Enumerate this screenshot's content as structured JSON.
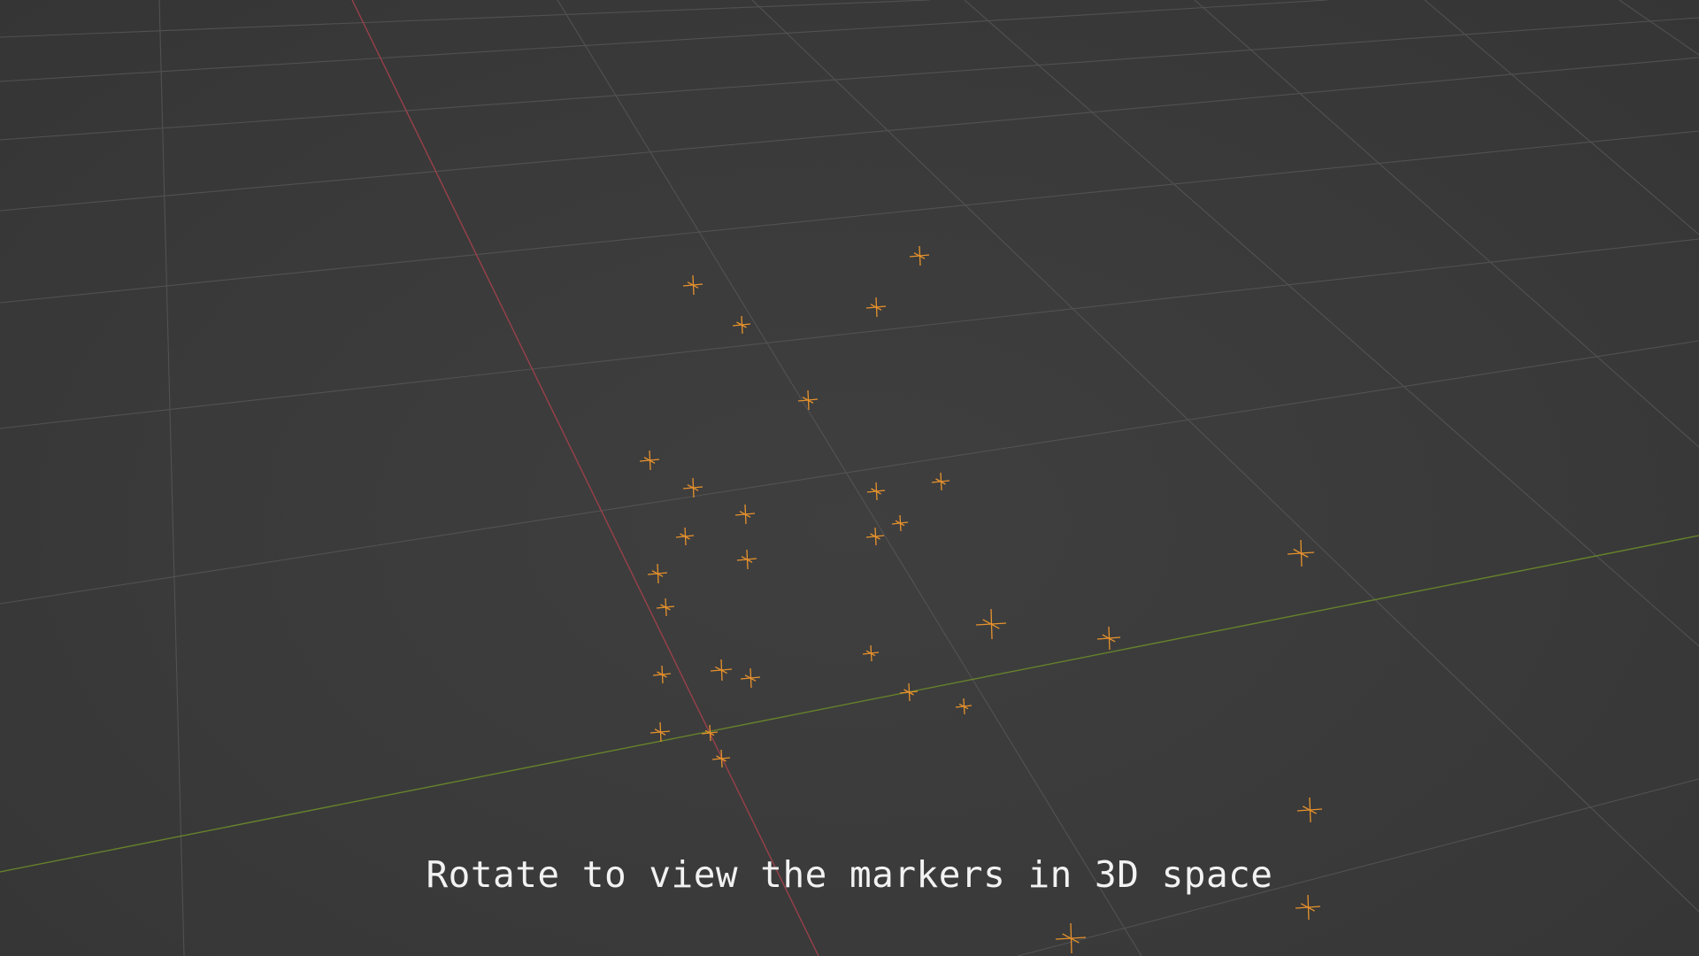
{
  "viewport": {
    "caption": "Rotate to view the markers in 3D space",
    "background_color": "#3d3d3d",
    "grid_color": "#5a5a5a",
    "x_axis_color": "#a3414b",
    "y_axis_color": "#6b8a2a",
    "marker_color": "#e8922c",
    "marker_icon": "empty-plain-axes-icon",
    "marker_count": 34
  }
}
